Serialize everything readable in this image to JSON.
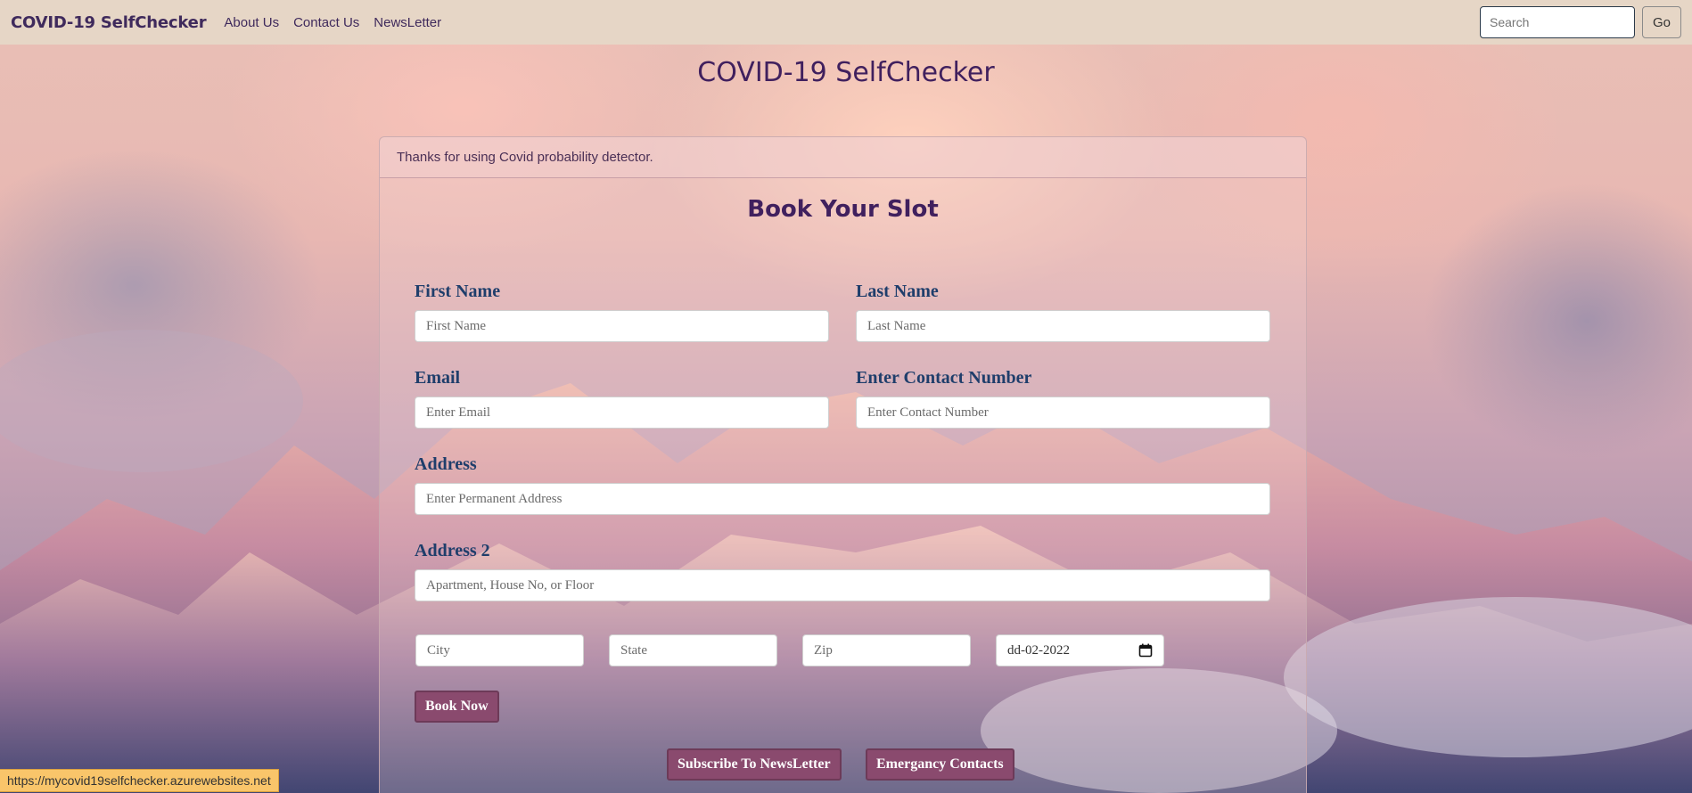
{
  "navbar": {
    "brand": "COVID-19 SelfChecker",
    "links": [
      "About Us",
      "Contact Us",
      "NewsLetter"
    ],
    "search_placeholder": "Search",
    "go_label": "Go"
  },
  "page_title": "COVID-19 SelfChecker",
  "card": {
    "header": "Thanks for using Covid probability detector.",
    "title": "Book Your Slot"
  },
  "form": {
    "first_name_label": "First Name",
    "first_name_placeholder": "First Name",
    "last_name_label": "Last Name",
    "last_name_placeholder": "Last Name",
    "email_label": "Email",
    "email_placeholder": "Enter Email",
    "contact_label": "Enter Contact Number",
    "contact_placeholder": "Enter Contact Number",
    "address_label": "Address",
    "address_placeholder": "Enter Permanent Address",
    "address2_label": "Address 2",
    "address2_placeholder": "Apartment, House No, or Floor",
    "city_placeholder": "City",
    "state_placeholder": "State",
    "zip_placeholder": "Zip",
    "date_value": "dd-02-2022",
    "book_now_label": "Book Now"
  },
  "footer_buttons": {
    "subscribe_label": "Subscribe To NewsLetter",
    "emergency_label": "Emergancy Contacts"
  },
  "status_bar": "https://mycovid19selfchecker.azurewebsites.net"
}
